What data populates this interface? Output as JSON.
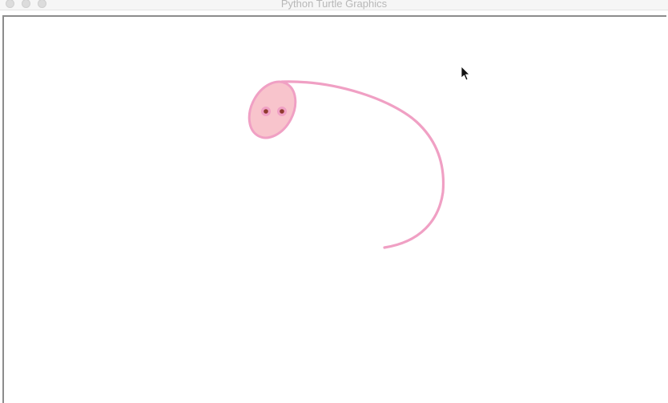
{
  "window": {
    "title": "Python Turtle Graphics",
    "controls": [
      "close",
      "minimize",
      "zoom"
    ]
  },
  "canvas": {
    "background": "#ffffff",
    "border_color": "#8c8c8c"
  },
  "drawing": {
    "stroke_color": "#f0a0c4",
    "fill_color": "#f8c4cc",
    "eye_color": "#8e3a2e",
    "eye_ring_color": "#f0a0c4"
  },
  "cursor": {
    "icon": "mouse-pointer-icon"
  }
}
